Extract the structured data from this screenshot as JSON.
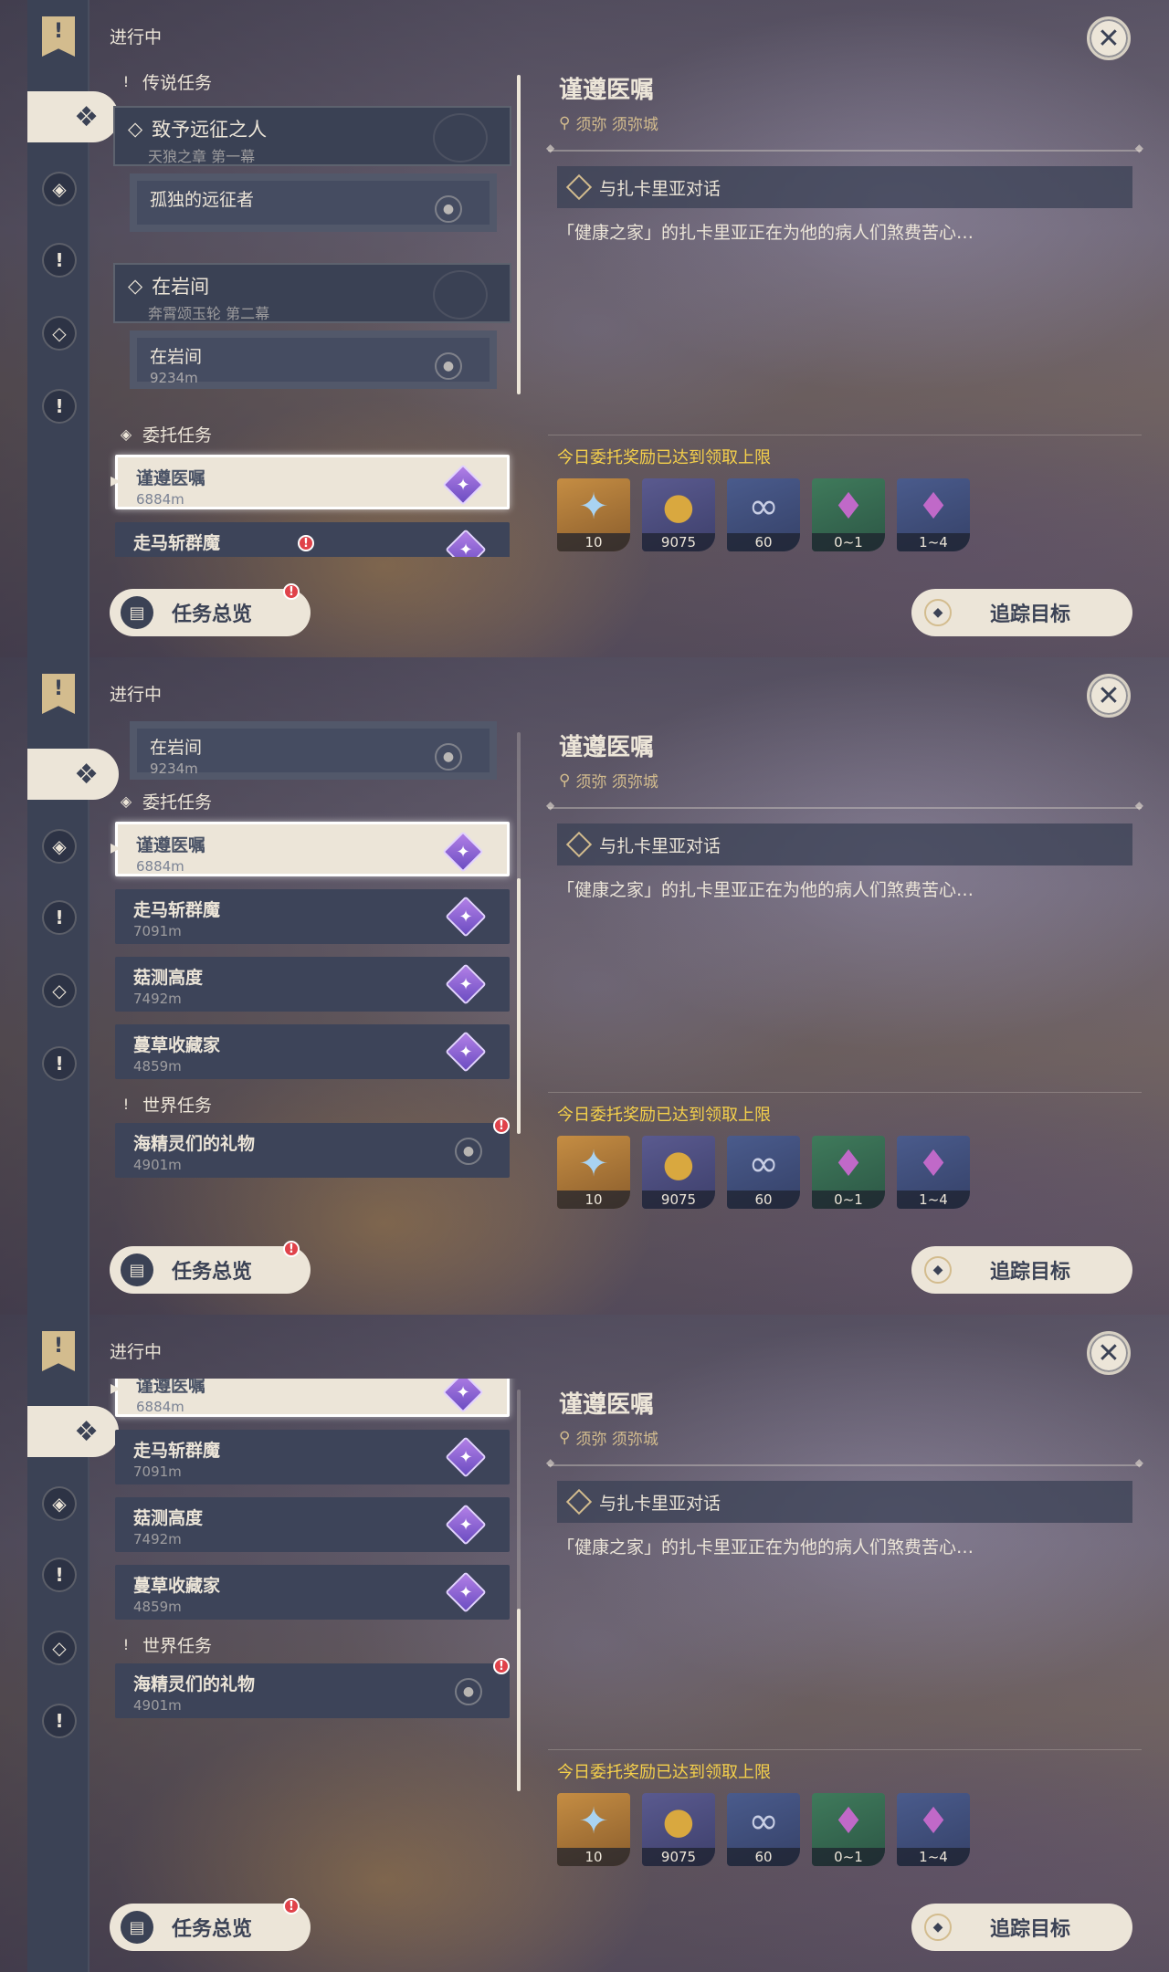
{
  "common": {
    "in_progress": "进行中",
    "close": "✕",
    "overview": "任务总览",
    "track": "追踪目标",
    "alert": "!"
  },
  "detail": {
    "title": "谨遵医嘱",
    "location": "须弥 须弥城",
    "objective": "与扎卡里亚对话",
    "description": "「健康之家」的扎卡里亚正在为他的病人们煞费苦心…",
    "reward_note": "今日委托奖励已达到领取上限",
    "rewards": [
      {
        "icon": "primogem-icon",
        "glyph": "✦",
        "count": "10",
        "color": "gold"
      },
      {
        "icon": "mora-icon",
        "glyph": "●",
        "count": "9075",
        "color": "purple"
      },
      {
        "icon": "friendship-exp-icon",
        "glyph": "∞",
        "count": "60",
        "color": "blue"
      },
      {
        "icon": "crystal-icon",
        "glyph": "♦",
        "count": "0~1",
        "color": "green"
      },
      {
        "icon": "crystal-cluster-icon",
        "glyph": "♦",
        "count": "1~4",
        "color": "blue"
      }
    ]
  },
  "sections": {
    "archon": "传说任务",
    "commission": "委托任务",
    "world": "世界任务"
  },
  "quests": {
    "archon1_title": "致予远征之人",
    "archon1_sub": "天狼之章 第一幕",
    "archon1_child": "孤独的远征者",
    "archon2_title": "在岩间",
    "archon2_sub": "奔霄颂玉轮 第二幕",
    "archon2_child": "在岩间",
    "archon2_child_dist": "9234m",
    "c1_title": "谨遵医嘱",
    "c1_dist": "6884m",
    "c2_title": "走马斩群魔",
    "c2_dist": "7091m",
    "c3_title": "菇测高度",
    "c3_dist": "7492m",
    "c4_title": "蔓草收藏家",
    "c4_dist": "4859m",
    "w1_title": "海精灵们的礼物",
    "w1_dist": "4901m"
  }
}
